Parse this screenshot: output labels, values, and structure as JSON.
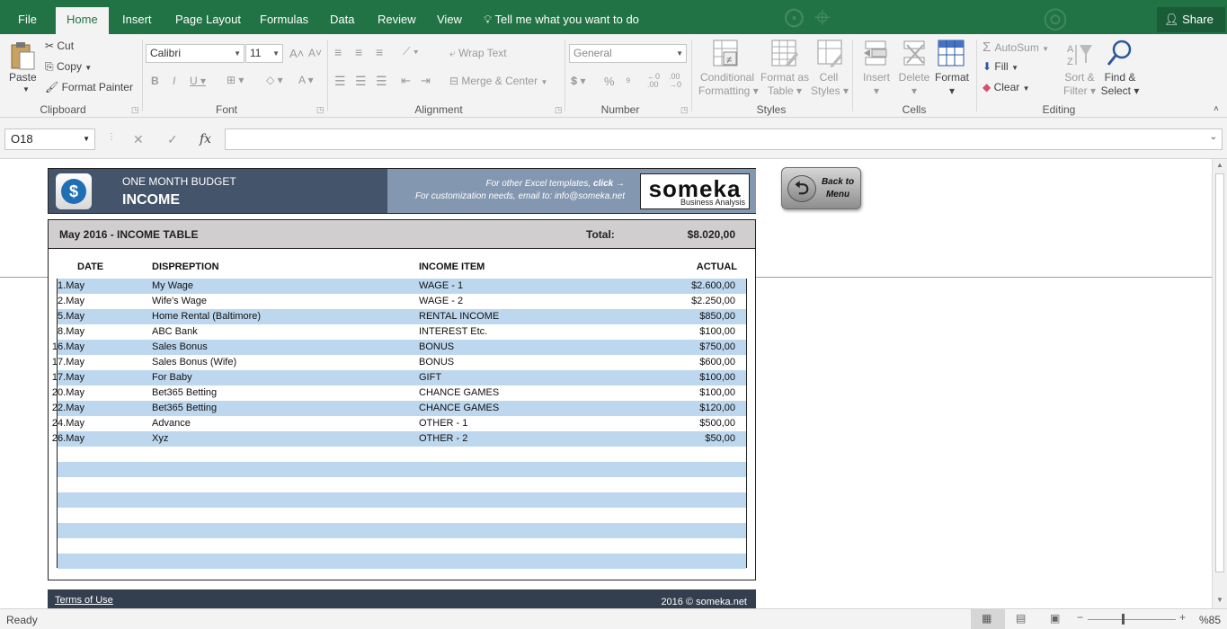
{
  "tabs": [
    "File",
    "Home",
    "Insert",
    "Page Layout",
    "Formulas",
    "Data",
    "Review",
    "View"
  ],
  "tell_me": "Tell me what you want to do",
  "share": "Share",
  "ribbon": {
    "clipboard": {
      "paste": "Paste",
      "cut": "Cut",
      "copy": "Copy",
      "format_painter": "Format Painter",
      "label": "Clipboard"
    },
    "font": {
      "name": "Calibri",
      "size": "11",
      "label": "Font"
    },
    "alignment": {
      "wrap_text": "Wrap Text",
      "merge_center": "Merge & Center",
      "label": "Alignment"
    },
    "number": {
      "format": "General",
      "label": "Number"
    },
    "styles": {
      "conditional": "Conditional",
      "formatting": "Formatting",
      "format_as": "Format as",
      "table": "Table",
      "cell": "Cell",
      "styles": "Styles",
      "label": "Styles"
    },
    "cells": {
      "insert": "Insert",
      "delete": "Delete",
      "format": "Format",
      "label": "Cells"
    },
    "editing": {
      "autosum": "AutoSum",
      "fill": "Fill",
      "clear": "Clear",
      "sort": "Sort &",
      "filter": "Filter",
      "find": "Find &",
      "select": "Select",
      "label": "Editing"
    }
  },
  "formula_bar": {
    "name_box": "O18",
    "fx": "fx"
  },
  "header": {
    "subtitle": "ONE MONTH BUDGET",
    "title": "INCOME",
    "promo_line1": "For other Excel templates,",
    "promo_click": "click →",
    "promo_line2": "For customization needs, email to: info@someka.net",
    "logo_main": "someka",
    "logo_sub": "Business Analysis"
  },
  "back_button": {
    "line1": "Back to",
    "line2": "Menu"
  },
  "table": {
    "title": "May 2016 - INCOME TABLE",
    "total_label": "Total:",
    "total_value": "$8.020,00",
    "columns": [
      "DATE",
      "DISPREPTION",
      "INCOME ITEM",
      "ACTUAL"
    ],
    "rows": [
      [
        "1.May",
        "My Wage",
        "WAGE - 1",
        "$2.600,00"
      ],
      [
        "2.May",
        "Wife's Wage",
        "WAGE - 2",
        "$2.250,00"
      ],
      [
        "5.May",
        "Home Rental (Baltimore)",
        "RENTAL INCOME",
        "$850,00"
      ],
      [
        "8.May",
        "ABC Bank",
        "INTEREST Etc.",
        "$100,00"
      ],
      [
        "16.May",
        "Sales Bonus",
        "BONUS",
        "$750,00"
      ],
      [
        "17.May",
        "Sales Bonus (Wife)",
        "BONUS",
        "$600,00"
      ],
      [
        "17.May",
        "For Baby",
        "GIFT",
        "$100,00"
      ],
      [
        "20.May",
        "Bet365 Betting",
        "CHANCE GAMES",
        "$100,00"
      ],
      [
        "22.May",
        "Bet365 Betting",
        "CHANCE GAMES",
        "$120,00"
      ],
      [
        "24.May",
        "Advance",
        "OTHER - 1",
        "$500,00"
      ],
      [
        "26.May",
        "Xyz",
        "OTHER - 2",
        "$50,00"
      ]
    ]
  },
  "footer": {
    "terms": "Terms of Use",
    "copyright": "2016 © someka.net"
  },
  "status": {
    "ready": "Ready",
    "zoom": "%85"
  }
}
